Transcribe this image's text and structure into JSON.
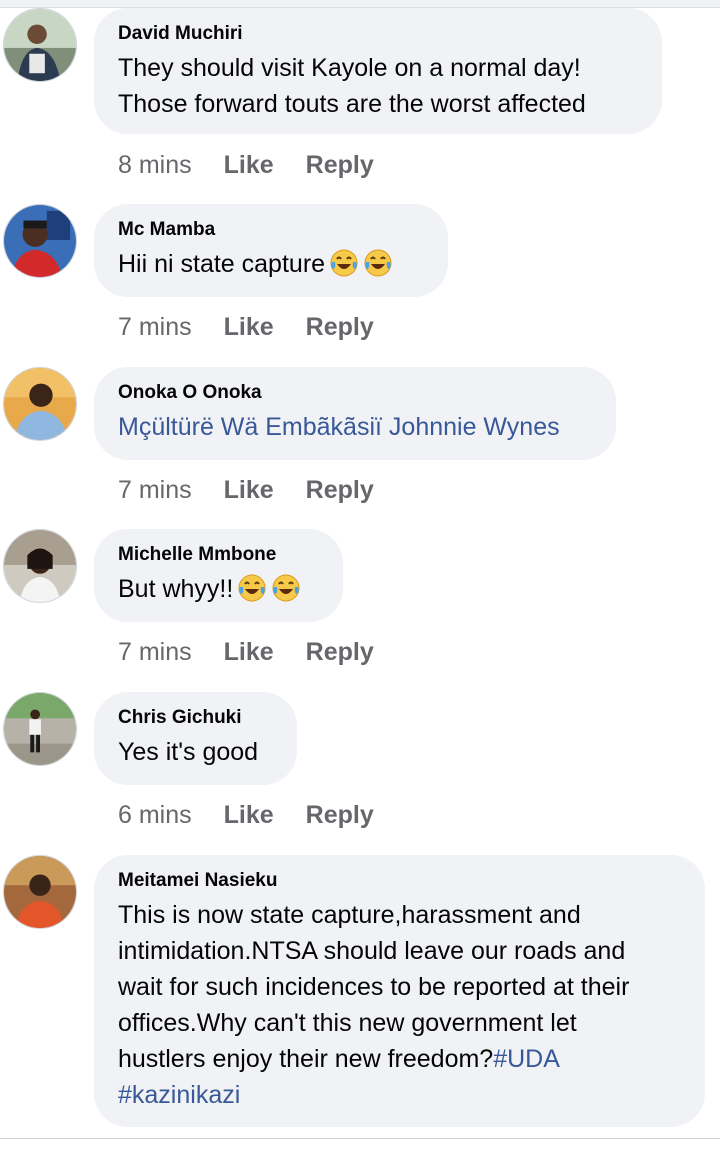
{
  "comments": [
    {
      "author": "David Muchiri",
      "text_lines": [
        "They should visit Kayole on a normal day!",
        "Those forward touts are the worst affected"
      ],
      "time": "8 mins",
      "like_label": "Like",
      "reply_label": "Reply"
    },
    {
      "author": "Mc Mamba",
      "text": "Hii ni state capture",
      "emoji": [
        "laughing-tears-emoji",
        "laughing-tears-emoji"
      ],
      "time": "7 mins",
      "like_label": "Like",
      "reply_label": "Reply"
    },
    {
      "author": "Onoka O Onoka",
      "tagged_name": "Mçültürë Wä Embãkãsiï Johnnie Wynes",
      "time": "7 mins",
      "like_label": "Like",
      "reply_label": "Reply"
    },
    {
      "author": "Michelle Mmbone",
      "text": "But whyy!!",
      "emoji": [
        "laughing-tears-emoji",
        "laughing-tears-emoji"
      ],
      "time": "7 mins",
      "like_label": "Like",
      "reply_label": "Reply"
    },
    {
      "author": "Chris Gichuki",
      "text": "Yes it's good",
      "time": "6 mins",
      "like_label": "Like",
      "reply_label": "Reply"
    },
    {
      "author": "Meitamei Nasieku",
      "text_lines": [
        "This is now state capture,harassment and",
        "intimidation.NTSA should leave our roads and",
        "wait for such incidences to be reported at their",
        "offices.Why can't this new government let",
        "hustlers enjoy their new freedom?"
      ],
      "hashtags": [
        "#UDA",
        "#kazinikazi"
      ]
    }
  ],
  "colors": {
    "bubble": "#f0f2f5",
    "meta_text": "#65676b",
    "link": "#385898",
    "primary_text": "#050505"
  }
}
